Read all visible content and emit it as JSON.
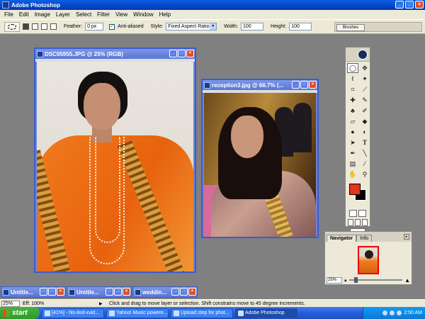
{
  "app": {
    "title": "Adobe Photoshop"
  },
  "window_controls": {
    "minimize": "_",
    "maximize": "□",
    "close": "×"
  },
  "menu": [
    "File",
    "Edit",
    "Image",
    "Layer",
    "Select",
    "Filter",
    "View",
    "Window",
    "Help"
  ],
  "options": {
    "feather_label": "Feather:",
    "feather_value": "0 px",
    "antialias_label": "Anti-aliased",
    "style_label": "Style:",
    "style_value": "Fixed Aspect Ratio",
    "width_label": "Width:",
    "width_value": "100",
    "height_label": "Height:",
    "height_value": "100",
    "brushes_tab": "Brushes"
  },
  "documents": [
    {
      "title": "DSC05955.JPG @ 25% (RGB)"
    },
    {
      "title": "reception3.jpg @ 66.7% (..."
    }
  ],
  "minimized": [
    {
      "title": "Untitle..."
    },
    {
      "title": "Untitle..."
    },
    {
      "title": "weddin..."
    }
  ],
  "navigator": {
    "tab1": "Navigator",
    "tab2": "Info",
    "zoom": "25%"
  },
  "status": {
    "zoom": "25%",
    "doc_info": "Eff: 100%",
    "message": "Click and drag to move layer or selection. Shift constrains move to 45 degree increments."
  },
  "taskbar": {
    "start": "start",
    "tasks": [
      {
        "label": "[41%] - hls-lind-xvid..."
      },
      {
        "label": "Yahoo! Music powere..."
      },
      {
        "label": "Upload step for phot..."
      },
      {
        "label": "Adobe Photoshop"
      }
    ],
    "clock": "2:50 AM"
  },
  "colors": {
    "foreground": "#e8321a",
    "background": "#000000"
  }
}
